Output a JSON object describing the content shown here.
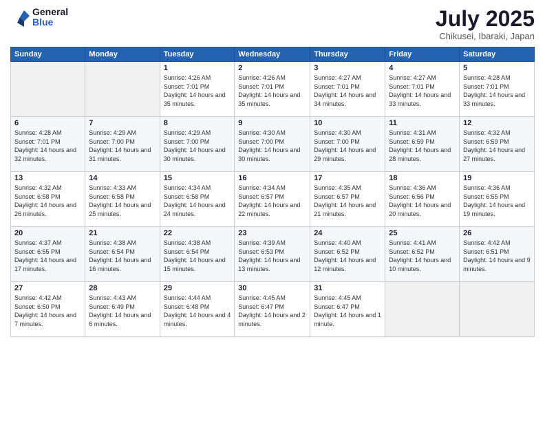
{
  "logo": {
    "general": "General",
    "blue": "Blue"
  },
  "header": {
    "month": "July 2025",
    "location": "Chikusei, Ibaraki, Japan"
  },
  "days_of_week": [
    "Sunday",
    "Monday",
    "Tuesday",
    "Wednesday",
    "Thursday",
    "Friday",
    "Saturday"
  ],
  "weeks": [
    [
      {
        "num": "",
        "sunrise": "",
        "sunset": "",
        "daylight": ""
      },
      {
        "num": "",
        "sunrise": "",
        "sunset": "",
        "daylight": ""
      },
      {
        "num": "1",
        "sunrise": "Sunrise: 4:26 AM",
        "sunset": "Sunset: 7:01 PM",
        "daylight": "Daylight: 14 hours and 35 minutes."
      },
      {
        "num": "2",
        "sunrise": "Sunrise: 4:26 AM",
        "sunset": "Sunset: 7:01 PM",
        "daylight": "Daylight: 14 hours and 35 minutes."
      },
      {
        "num": "3",
        "sunrise": "Sunrise: 4:27 AM",
        "sunset": "Sunset: 7:01 PM",
        "daylight": "Daylight: 14 hours and 34 minutes."
      },
      {
        "num": "4",
        "sunrise": "Sunrise: 4:27 AM",
        "sunset": "Sunset: 7:01 PM",
        "daylight": "Daylight: 14 hours and 33 minutes."
      },
      {
        "num": "5",
        "sunrise": "Sunrise: 4:28 AM",
        "sunset": "Sunset: 7:01 PM",
        "daylight": "Daylight: 14 hours and 33 minutes."
      }
    ],
    [
      {
        "num": "6",
        "sunrise": "Sunrise: 4:28 AM",
        "sunset": "Sunset: 7:01 PM",
        "daylight": "Daylight: 14 hours and 32 minutes."
      },
      {
        "num": "7",
        "sunrise": "Sunrise: 4:29 AM",
        "sunset": "Sunset: 7:00 PM",
        "daylight": "Daylight: 14 hours and 31 minutes."
      },
      {
        "num": "8",
        "sunrise": "Sunrise: 4:29 AM",
        "sunset": "Sunset: 7:00 PM",
        "daylight": "Daylight: 14 hours and 30 minutes."
      },
      {
        "num": "9",
        "sunrise": "Sunrise: 4:30 AM",
        "sunset": "Sunset: 7:00 PM",
        "daylight": "Daylight: 14 hours and 30 minutes."
      },
      {
        "num": "10",
        "sunrise": "Sunrise: 4:30 AM",
        "sunset": "Sunset: 7:00 PM",
        "daylight": "Daylight: 14 hours and 29 minutes."
      },
      {
        "num": "11",
        "sunrise": "Sunrise: 4:31 AM",
        "sunset": "Sunset: 6:59 PM",
        "daylight": "Daylight: 14 hours and 28 minutes."
      },
      {
        "num": "12",
        "sunrise": "Sunrise: 4:32 AM",
        "sunset": "Sunset: 6:59 PM",
        "daylight": "Daylight: 14 hours and 27 minutes."
      }
    ],
    [
      {
        "num": "13",
        "sunrise": "Sunrise: 4:32 AM",
        "sunset": "Sunset: 6:58 PM",
        "daylight": "Daylight: 14 hours and 26 minutes."
      },
      {
        "num": "14",
        "sunrise": "Sunrise: 4:33 AM",
        "sunset": "Sunset: 6:58 PM",
        "daylight": "Daylight: 14 hours and 25 minutes."
      },
      {
        "num": "15",
        "sunrise": "Sunrise: 4:34 AM",
        "sunset": "Sunset: 6:58 PM",
        "daylight": "Daylight: 14 hours and 24 minutes."
      },
      {
        "num": "16",
        "sunrise": "Sunrise: 4:34 AM",
        "sunset": "Sunset: 6:57 PM",
        "daylight": "Daylight: 14 hours and 22 minutes."
      },
      {
        "num": "17",
        "sunrise": "Sunrise: 4:35 AM",
        "sunset": "Sunset: 6:57 PM",
        "daylight": "Daylight: 14 hours and 21 minutes."
      },
      {
        "num": "18",
        "sunrise": "Sunrise: 4:36 AM",
        "sunset": "Sunset: 6:56 PM",
        "daylight": "Daylight: 14 hours and 20 minutes."
      },
      {
        "num": "19",
        "sunrise": "Sunrise: 4:36 AM",
        "sunset": "Sunset: 6:55 PM",
        "daylight": "Daylight: 14 hours and 19 minutes."
      }
    ],
    [
      {
        "num": "20",
        "sunrise": "Sunrise: 4:37 AM",
        "sunset": "Sunset: 6:55 PM",
        "daylight": "Daylight: 14 hours and 17 minutes."
      },
      {
        "num": "21",
        "sunrise": "Sunrise: 4:38 AM",
        "sunset": "Sunset: 6:54 PM",
        "daylight": "Daylight: 14 hours and 16 minutes."
      },
      {
        "num": "22",
        "sunrise": "Sunrise: 4:38 AM",
        "sunset": "Sunset: 6:54 PM",
        "daylight": "Daylight: 14 hours and 15 minutes."
      },
      {
        "num": "23",
        "sunrise": "Sunrise: 4:39 AM",
        "sunset": "Sunset: 6:53 PM",
        "daylight": "Daylight: 14 hours and 13 minutes."
      },
      {
        "num": "24",
        "sunrise": "Sunrise: 4:40 AM",
        "sunset": "Sunset: 6:52 PM",
        "daylight": "Daylight: 14 hours and 12 minutes."
      },
      {
        "num": "25",
        "sunrise": "Sunrise: 4:41 AM",
        "sunset": "Sunset: 6:52 PM",
        "daylight": "Daylight: 14 hours and 10 minutes."
      },
      {
        "num": "26",
        "sunrise": "Sunrise: 4:42 AM",
        "sunset": "Sunset: 6:51 PM",
        "daylight": "Daylight: 14 hours and 9 minutes."
      }
    ],
    [
      {
        "num": "27",
        "sunrise": "Sunrise: 4:42 AM",
        "sunset": "Sunset: 6:50 PM",
        "daylight": "Daylight: 14 hours and 7 minutes."
      },
      {
        "num": "28",
        "sunrise": "Sunrise: 4:43 AM",
        "sunset": "Sunset: 6:49 PM",
        "daylight": "Daylight: 14 hours and 6 minutes."
      },
      {
        "num": "29",
        "sunrise": "Sunrise: 4:44 AM",
        "sunset": "Sunset: 6:48 PM",
        "daylight": "Daylight: 14 hours and 4 minutes."
      },
      {
        "num": "30",
        "sunrise": "Sunrise: 4:45 AM",
        "sunset": "Sunset: 6:47 PM",
        "daylight": "Daylight: 14 hours and 2 minutes."
      },
      {
        "num": "31",
        "sunrise": "Sunrise: 4:45 AM",
        "sunset": "Sunset: 6:47 PM",
        "daylight": "Daylight: 14 hours and 1 minute."
      },
      {
        "num": "",
        "sunrise": "",
        "sunset": "",
        "daylight": ""
      },
      {
        "num": "",
        "sunrise": "",
        "sunset": "",
        "daylight": ""
      }
    ]
  ]
}
